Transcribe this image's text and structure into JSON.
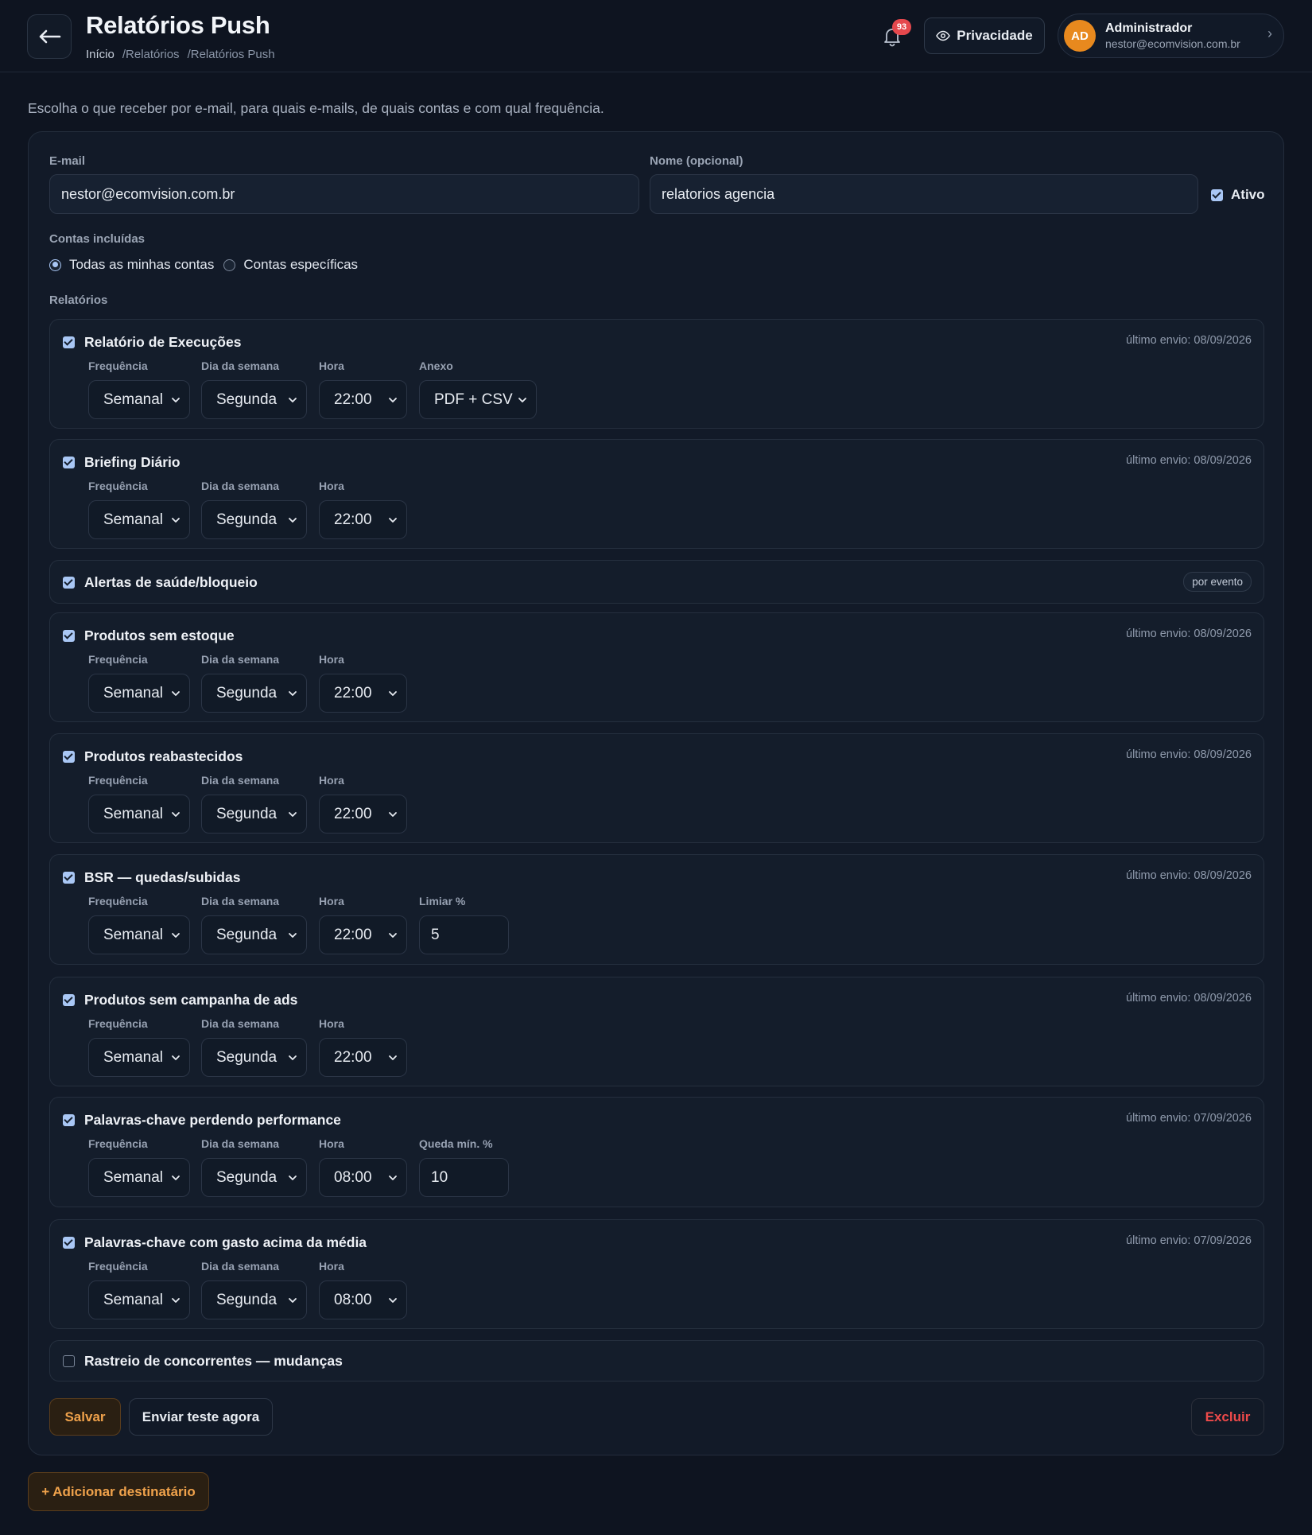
{
  "header": {
    "title": "Relatórios Push",
    "breadcrumb": [
      "Início",
      "/Relatórios",
      "/Relatórios Push"
    ],
    "notifications_count": "93",
    "privacy_label": "Privacidade",
    "user": {
      "initials": "AD",
      "name": "Administrador",
      "email": "nestor@ecomvision.com.br"
    }
  },
  "intro": "Escolha o que receber por e-mail, para quais e-mails, de quais contas e com qual frequência.",
  "form": {
    "email_label": "E-mail",
    "email_value": "nestor@ecomvision.com.br",
    "name_label": "Nome (opcional)",
    "name_value": "relatorios agencia",
    "active_label": "Ativo",
    "accounts_label": "Contas incluídas",
    "accounts_all": "Todas as minhas contas",
    "accounts_specific": "Contas específicas",
    "reports_label": "Relatórios"
  },
  "field_labels": {
    "frequency": "Frequência",
    "weekday": "Dia da semana",
    "hour": "Hora"
  },
  "reports": [
    {
      "title": "Relatório de Execuções",
      "checked": true,
      "last_sent": "último envio: 08/09/2026",
      "frequency": "Semanal",
      "weekday": "Segunda",
      "hour": "22:00",
      "extra_label": "Anexo",
      "extra_value": "PDF + CSV"
    },
    {
      "title": "Briefing Diário",
      "checked": true,
      "last_sent": "último envio: 08/09/2026",
      "frequency": "Semanal",
      "weekday": "Segunda",
      "hour": "22:00"
    },
    {
      "title": "Alertas de saúde/bloqueio",
      "checked": true,
      "badge": "por evento"
    },
    {
      "title": "Produtos sem estoque",
      "checked": true,
      "last_sent": "último envio: 08/09/2026",
      "frequency": "Semanal",
      "weekday": "Segunda",
      "hour": "22:00"
    },
    {
      "title": "Produtos reabastecidos",
      "checked": true,
      "last_sent": "último envio: 08/09/2026",
      "frequency": "Semanal",
      "weekday": "Segunda",
      "hour": "22:00"
    },
    {
      "title": "BSR — quedas/subidas",
      "checked": true,
      "last_sent": "último envio: 08/09/2026",
      "frequency": "Semanal",
      "weekday": "Segunda",
      "hour": "22:00",
      "extra_label": "Limiar %",
      "extra_value": "5"
    },
    {
      "title": "Produtos sem campanha de ads",
      "checked": true,
      "last_sent": "último envio: 08/09/2026",
      "frequency": "Semanal",
      "weekday": "Segunda",
      "hour": "22:00"
    },
    {
      "title": "Palavras-chave perdendo performance",
      "checked": true,
      "last_sent": "último envio: 07/09/2026",
      "frequency": "Semanal",
      "weekday": "Segunda",
      "hour": "08:00",
      "extra_label": "Queda mín. %",
      "extra_value": "10"
    },
    {
      "title": "Palavras-chave com gasto acima da média",
      "checked": true,
      "last_sent": "último envio: 07/09/2026",
      "frequency": "Semanal",
      "weekday": "Segunda",
      "hour": "08:00"
    },
    {
      "title": "Rastreio de concorrentes — mudanças",
      "checked": false
    }
  ],
  "actions": {
    "save": "Salvar",
    "send_test": "Enviar teste agora",
    "delete": "Excluir",
    "add_recipient": "+ Adicionar destinatário"
  },
  "colors": {
    "accent": "#f0a24b",
    "danger": "#ef4a4a",
    "checkbox": "#a9c7f5",
    "background": "#0e1420"
  }
}
